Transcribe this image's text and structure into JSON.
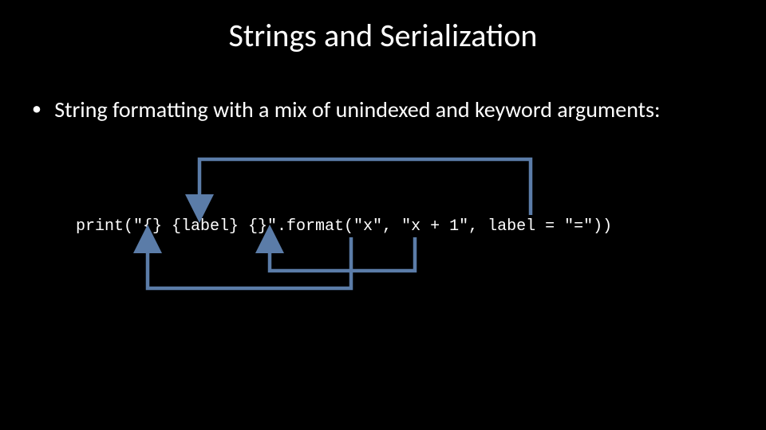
{
  "title": "Strings and Serialization",
  "bullet": "String formatting with a mix of unindexed and keyword arguments:",
  "code": "print(\"{} {label} {}\".format(\"x\", \"x + 1\", label = \"=\"))",
  "arrow_color": "#5b7ca8"
}
